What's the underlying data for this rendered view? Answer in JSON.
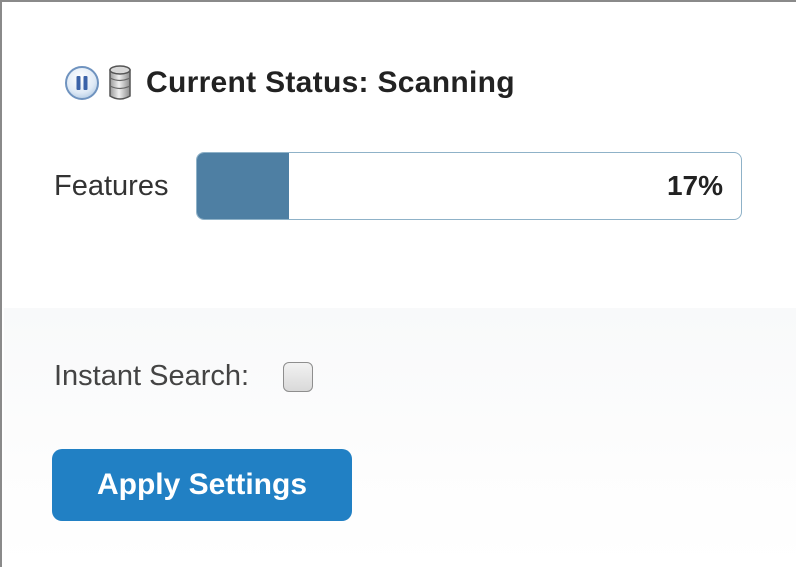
{
  "status": {
    "text": "Current Status: Scanning",
    "pause_icon": "pause-icon",
    "database_icon": "database-icon"
  },
  "progress": {
    "label": "Features",
    "percent_text": "17%",
    "fraction": 0.17,
    "fill_color": "#4e7fa3"
  },
  "settings": {
    "instant_search_label": "Instant Search:",
    "instant_search_checked": false,
    "apply_label": "Apply Settings",
    "apply_color": "#2180c4"
  }
}
